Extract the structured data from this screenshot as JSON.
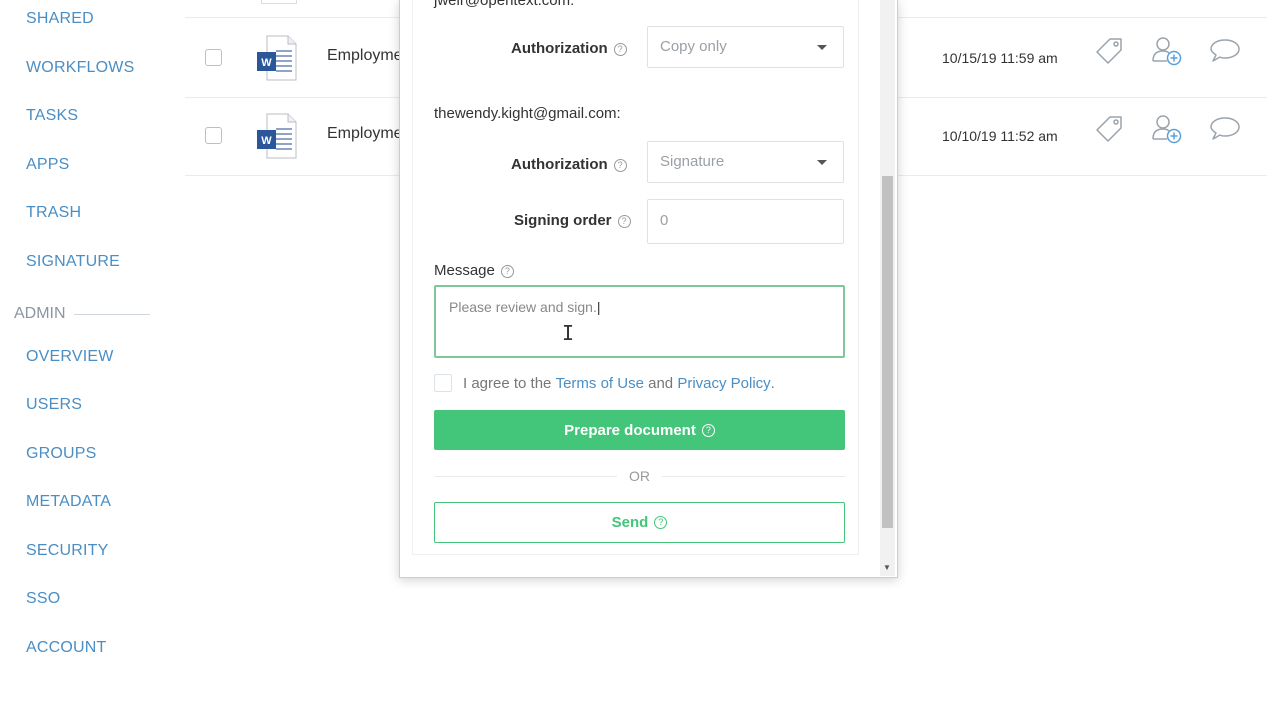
{
  "sidebar": {
    "items": [
      {
        "label": "SHARED"
      },
      {
        "label": "WORKFLOWS"
      },
      {
        "label": "TASKS"
      },
      {
        "label": "APPS"
      },
      {
        "label": "TRASH"
      },
      {
        "label": "SIGNATURE"
      }
    ],
    "admin_heading": "ADMIN",
    "admin_items": [
      {
        "label": "OVERVIEW"
      },
      {
        "label": "USERS"
      },
      {
        "label": "GROUPS"
      },
      {
        "label": "METADATA"
      },
      {
        "label": "SECURITY"
      },
      {
        "label": "SSO"
      },
      {
        "label": "ACCOUNT"
      }
    ]
  },
  "files": [
    {
      "name": "Employment",
      "date": "10/15/19 11:59 am",
      "icon": "word-doc-icon"
    },
    {
      "name": "Employment",
      "date": "10/10/19 11:52 am",
      "icon": "word-doc-icon"
    }
  ],
  "dialog": {
    "recipient1": {
      "email": "jweir@opentext.com:",
      "authorization_label": "Authorization",
      "authorization_value": "Copy only"
    },
    "recipient2": {
      "email": "thewendy.kight@gmail.com:",
      "authorization_label": "Authorization",
      "authorization_value": "Signature",
      "signing_order_label": "Signing order",
      "signing_order_value": "0"
    },
    "message_label": "Message",
    "message_value": "Please review and sign.",
    "agree_prefix": "I agree to the ",
    "terms_link": "Terms of Use",
    "agree_and": " and ",
    "privacy_link": "Privacy Policy",
    "agree_suffix": ".",
    "prepare_button": "Prepare document",
    "or_text": "OR",
    "send_button": "Send"
  },
  "colors": {
    "accent_green": "#43c57a",
    "link_blue": "#4a8ec4",
    "focus_green": "#7fc79b"
  }
}
